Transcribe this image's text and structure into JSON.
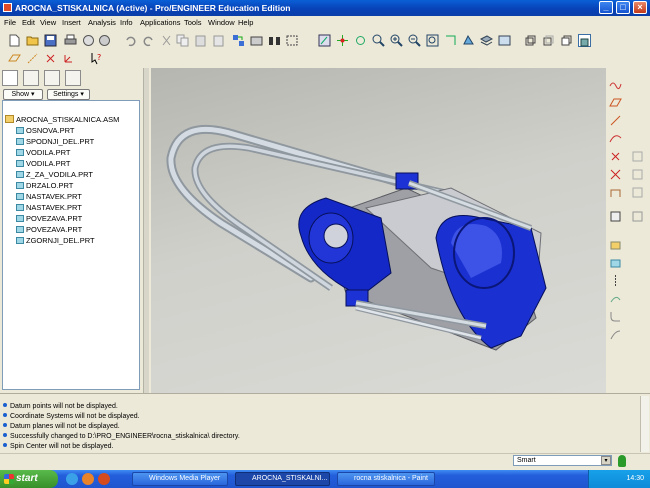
{
  "window": {
    "title": "AROCNA_STISKALNICA (Active) - Pro/ENGINEER Education Edition",
    "min": "_",
    "max": "□",
    "close": "×"
  },
  "menu": [
    "File",
    "Edit",
    "View",
    "Insert",
    "Analysis",
    "Info",
    "Applications",
    "Tools",
    "Window",
    "Help"
  ],
  "navigator": {
    "show_label": "Show ▾",
    "settings_label": "Settings ▾"
  },
  "tree": {
    "root": "AROCNA_STISKALNICA.ASM",
    "items": [
      "OSNOVA.PRT",
      "SPODNJI_DEL.PRT",
      "VODILA.PRT",
      "VODILA.PRT",
      "Z_ZA_VODILA.PRT",
      "DRZALO.PRT",
      "NASTAVEK.PRT",
      "NASTAVEK.PRT",
      "POVEZAVA.PRT",
      "POVEZAVA.PRT",
      "ZGORNJI_DEL.PRT"
    ]
  },
  "messages": [
    "Datum points will not be displayed.",
    "Coordinate Systems will not be displayed.",
    "Datum planes will not be displayed.",
    "Successfully changed to D:\\PRO_ENGINEER\\rocna_stiskalnica\\ directory.",
    "Spin Center will not be displayed."
  ],
  "filter": {
    "value": "Smart"
  },
  "taskbar": {
    "start": "start",
    "tasks": [
      "Windows Media Player",
      "AROCNA_STISKALNI...",
      "rocna stiskalnica - Paint"
    ],
    "clock": "14:30"
  },
  "colors": {
    "model_blue": "#1428c8",
    "rod_gray": "#c8cfd6",
    "titlebar": "#0a5fd6"
  }
}
